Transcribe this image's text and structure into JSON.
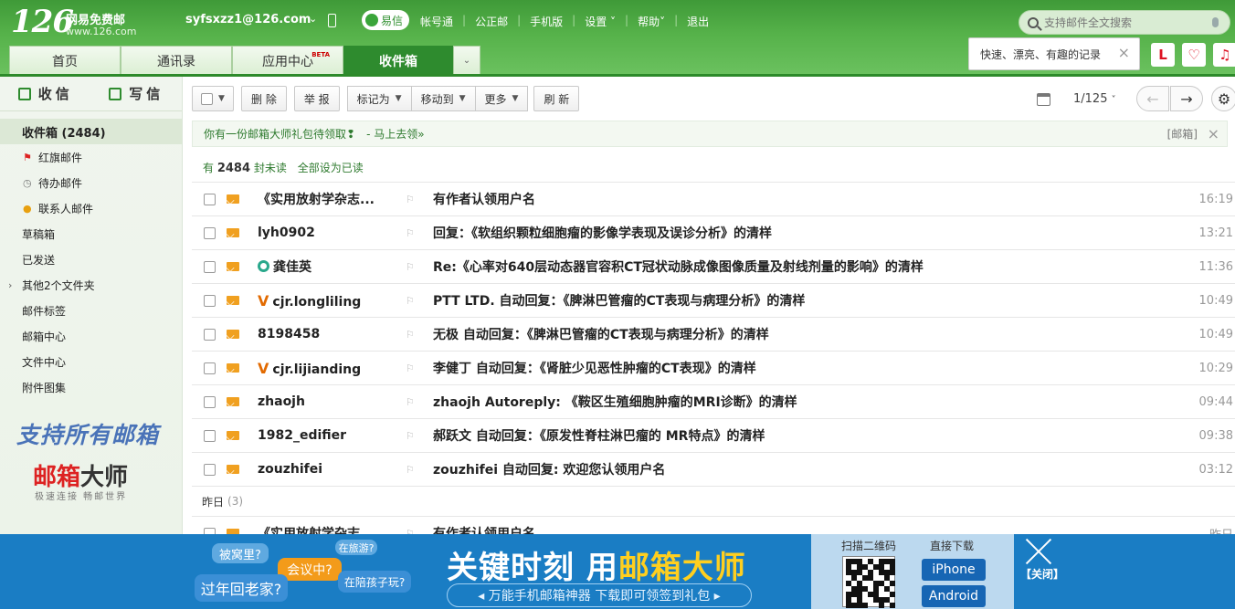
{
  "header": {
    "logo_num": "126",
    "logo_name": "网易免费邮",
    "logo_url": "www.126.com",
    "account": "syfsxzz1@126.com",
    "yixin": "易信",
    "nav": [
      "帐号通",
      "公正邮",
      "手机版",
      "设置",
      "帮助",
      "退出"
    ],
    "search_placeholder": "支持邮件全文搜索",
    "tip": "快速、漂亮、有趣的记录",
    "apps": [
      "L",
      "♡",
      "♫"
    ]
  },
  "tabs": [
    "首页",
    "通讯录",
    "应用中心",
    "收件箱"
  ],
  "tab_beta": "BETA",
  "sidebar": {
    "receive": "收信",
    "write": "写信",
    "folders": [
      {
        "label": "收件箱 (2484)"
      },
      {
        "label": "红旗邮件"
      },
      {
        "label": "待办邮件"
      },
      {
        "label": "联系人邮件"
      },
      {
        "label": "草稿箱"
      },
      {
        "label": "已发送"
      },
      {
        "label": "其他2个文件夹"
      },
      {
        "label": "邮件标签"
      },
      {
        "label": "邮箱中心"
      },
      {
        "label": "文件中心"
      },
      {
        "label": "附件图集"
      }
    ],
    "ad_line1": "支持所有邮箱",
    "ad_line2_red": "邮箱",
    "ad_line2_black": "大师",
    "ad_line3": "极速连接 畅邮世界"
  },
  "toolbar": {
    "delete": "删 除",
    "report": "举 报",
    "mark_as": "标记为",
    "move_to": "移动到",
    "more": "更多",
    "refresh": "刷 新",
    "pager": "1/125"
  },
  "promo_bar": {
    "text": "你有一份邮箱大师礼包待领取❢",
    "link": "- 马上去领»",
    "tag": "[邮箱]"
  },
  "unread": {
    "pre": "有",
    "count": "2484",
    "post": "封未读",
    "action": "全部设为已读"
  },
  "messages": [
    {
      "sender": "《实用放射学杂志...",
      "subject": "有作者认领用户名",
      "time": "16:19",
      "badge": ""
    },
    {
      "sender": "lyh0902",
      "subject": "回复：《软组织颗粒细胞瘤的影像学表现及误诊分析》的清样",
      "time": "13:21",
      "badge": ""
    },
    {
      "sender": "龚佳英",
      "subject": "Re:《心率对640层动态器官容积CT冠状动脉成像图像质量及射线剂量的影响》的清样",
      "time": "11:36",
      "badge": "yixin"
    },
    {
      "sender": "cjr.longliling",
      "subject": "PTT LTD. 自动回复：《脾淋巴管瘤的CT表现与病理分析》的清样",
      "time": "10:49",
      "badge": "V"
    },
    {
      "sender": "8198458",
      "subject": "无极 自动回复：《脾淋巴管瘤的CT表现与病理分析》的清样",
      "time": "10:49",
      "badge": ""
    },
    {
      "sender": "cjr.lijianding",
      "subject": "李健丁 自动回复：《肾脏少见恶性肿瘤的CT表现》的清样",
      "time": "10:29",
      "badge": "V"
    },
    {
      "sender": "zhaojh",
      "subject": "zhaojh Autoreply: 《鞍区生殖细胞肿瘤的MRI诊断》的清样",
      "time": "09:44",
      "badge": ""
    },
    {
      "sender": "1982_edifier",
      "subject": "郝跃文 自动回复：《原发性脊柱淋巴瘤的 MR特点》的清样",
      "time": "09:38",
      "badge": ""
    },
    {
      "sender": "zouzhifei",
      "subject": "zouzhifei 自动回复: 欢迎您认领用户名",
      "time": "03:12",
      "badge": ""
    }
  ],
  "group": {
    "label": "昨日",
    "count": "(3)"
  },
  "yesterday": [
    {
      "sender": "《实用放射学杂志...",
      "subject": "有作者认领用户名",
      "time": "昨日"
    }
  ],
  "banner": {
    "bubbles": [
      "被窝里?",
      "在旅游?",
      "会议中?",
      "过年回老家?",
      "在陪孩子玩?"
    ],
    "title_white": "关键时刻 用",
    "title_yellow": "邮箱大师",
    "subtitle": "◂ 万能手机邮箱神器 下载即可领签到礼包 ▸",
    "qr_label": "扫描二维码",
    "dl_label": "直接下载",
    "iphone": "iPhone",
    "android": "Android",
    "close": "【关闭】"
  }
}
